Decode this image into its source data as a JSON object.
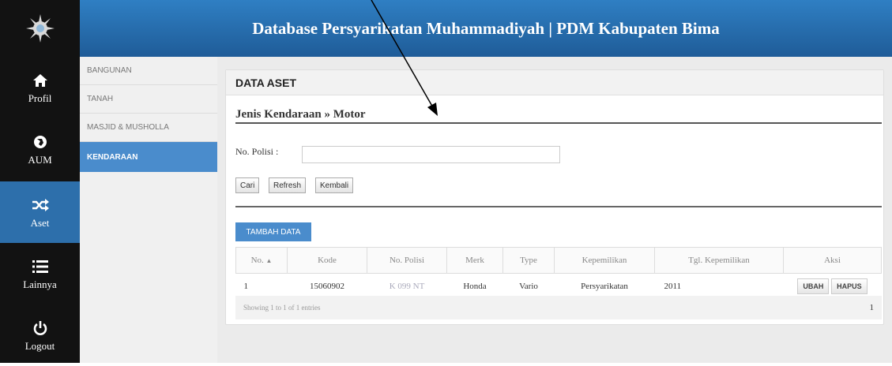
{
  "header": {
    "title": "Database Persyarikatan Muhammadiyah | PDM Kabupaten Bima"
  },
  "nav": [
    {
      "label": "Profil",
      "icon": "home-icon"
    },
    {
      "label": "AUM",
      "icon": "globe-icon"
    },
    {
      "label": "Aset",
      "icon": "shuffle-icon"
    },
    {
      "label": "Lainnya",
      "icon": "list-icon"
    },
    {
      "label": "Logout",
      "icon": "power-icon"
    }
  ],
  "subnav": [
    "Bangunan",
    "Tanah",
    "Masjid & Musholla",
    "Kendaraan"
  ],
  "panel": {
    "title": "DATA ASET",
    "breadcrumb": "Jenis Kendaraan » Motor",
    "search_label": "No. Polisi  :",
    "buttons": {
      "cari": "Cari",
      "refresh": "Refresh",
      "kembali": "Kembali",
      "tambah": "Tambah Data"
    }
  },
  "table": {
    "headers": [
      "No.",
      "Kode",
      "No. Polisi",
      "Merk",
      "Type",
      "Kepemilikan",
      "Tgl. Kepemilikan",
      "Aksi"
    ],
    "rows": [
      {
        "no": "1",
        "kode": "15060902",
        "polisi": "K 099 NT",
        "merk": "Honda",
        "type": "Vario",
        "kepemilikan": "Persyarikatan",
        "tgl": "2011",
        "ubah": "UBAH",
        "hapus": "HAPUS"
      }
    ],
    "footer_info": "Showing 1 to 1 of 1 entries",
    "page": "1"
  },
  "colors": {
    "header_blue": "#2a72b5",
    "active_blue": "#4a8ccc",
    "sidebar_dark": "#121212"
  }
}
